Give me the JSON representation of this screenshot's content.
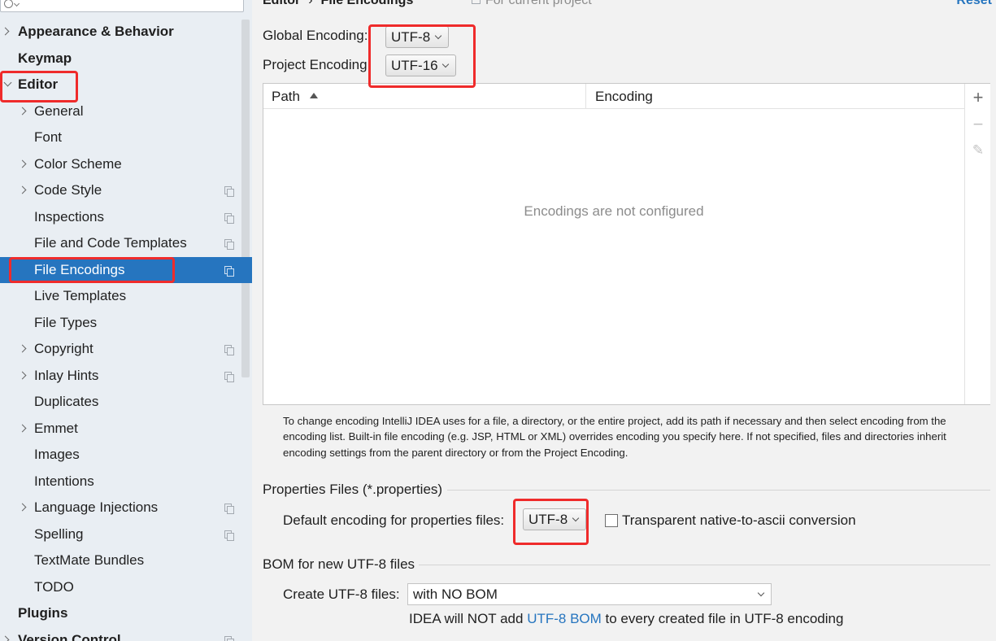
{
  "sidebar": {
    "search_placeholder": "",
    "items": [
      {
        "label": "Appearance & Behavior",
        "level": 0,
        "arrow": "right",
        "copy": false
      },
      {
        "label": "Keymap",
        "level": 0,
        "arrow": "",
        "copy": false
      },
      {
        "label": "Editor",
        "level": 0,
        "arrow": "down",
        "copy": false
      },
      {
        "label": "General",
        "level": 1,
        "arrow": "right",
        "copy": false
      },
      {
        "label": "Font",
        "level": 1,
        "arrow": "",
        "copy": false
      },
      {
        "label": "Color Scheme",
        "level": 1,
        "arrow": "right",
        "copy": false
      },
      {
        "label": "Code Style",
        "level": 1,
        "arrow": "right",
        "copy": true
      },
      {
        "label": "Inspections",
        "level": 1,
        "arrow": "",
        "copy": true
      },
      {
        "label": "File and Code Templates",
        "level": 1,
        "arrow": "",
        "copy": true
      },
      {
        "label": "File Encodings",
        "level": 1,
        "arrow": "",
        "copy": true,
        "selected": true
      },
      {
        "label": "Live Templates",
        "level": 1,
        "arrow": "",
        "copy": false
      },
      {
        "label": "File Types",
        "level": 1,
        "arrow": "",
        "copy": false
      },
      {
        "label": "Copyright",
        "level": 1,
        "arrow": "right",
        "copy": true
      },
      {
        "label": "Inlay Hints",
        "level": 1,
        "arrow": "right",
        "copy": true
      },
      {
        "label": "Duplicates",
        "level": 1,
        "arrow": "",
        "copy": false
      },
      {
        "label": "Emmet",
        "level": 1,
        "arrow": "right",
        "copy": false
      },
      {
        "label": "Images",
        "level": 1,
        "arrow": "",
        "copy": false
      },
      {
        "label": "Intentions",
        "level": 1,
        "arrow": "",
        "copy": false
      },
      {
        "label": "Language Injections",
        "level": 1,
        "arrow": "right",
        "copy": true
      },
      {
        "label": "Spelling",
        "level": 1,
        "arrow": "",
        "copy": true
      },
      {
        "label": "TextMate Bundles",
        "level": 1,
        "arrow": "",
        "copy": false
      },
      {
        "label": "TODO",
        "level": 1,
        "arrow": "",
        "copy": false
      },
      {
        "label": "Plugins",
        "level": 0,
        "arrow": "",
        "copy": false
      },
      {
        "label": "Version Control",
        "level": 0,
        "arrow": "right",
        "copy": true
      }
    ]
  },
  "header": {
    "breadcrumb_parent": "Editor",
    "breadcrumb_separator": "›",
    "breadcrumb_current": "File Encodings",
    "scope_hint": "For current project",
    "reset_label": "Reset"
  },
  "encodings": {
    "global_label": "Global Encoding:",
    "global_value": "UTF-8",
    "project_label": "Project Encoding",
    "project_value": "UTF-16"
  },
  "table": {
    "col_path": "Path",
    "col_encoding": "Encoding",
    "empty_message": "Encodings are not configured",
    "add_symbol": "+",
    "remove_symbol": "−",
    "edit_symbol": "✎"
  },
  "help_text": "To change encoding IntelliJ IDEA uses for a file, a directory, or the entire project, add its path if necessary and then select encoding from the encoding list. Built-in file encoding (e.g. JSP, HTML or XML) overrides encoding you specify here. If not specified, files and directories inherit encoding settings from the parent directory or from the Project Encoding.",
  "properties": {
    "section_title": "Properties Files (*.properties)",
    "default_label": "Default encoding for properties files:",
    "default_value": "UTF-8",
    "native_to_ascii_label": "Transparent native-to-ascii conversion",
    "native_to_ascii_checked": false
  },
  "bom": {
    "section_title": "BOM for new UTF-8 files",
    "create_label": "Create UTF-8 files:",
    "create_value": "with NO BOM",
    "note_prefix": "IDEA will NOT add ",
    "note_link": "UTF-8 BOM",
    "note_suffix": " to every created file in UTF-8 encoding"
  },
  "colors": {
    "selection": "#2675bf",
    "link": "#2675bf",
    "highlight": "#ef2b2b",
    "sidebar_bg": "#e9eef3"
  }
}
